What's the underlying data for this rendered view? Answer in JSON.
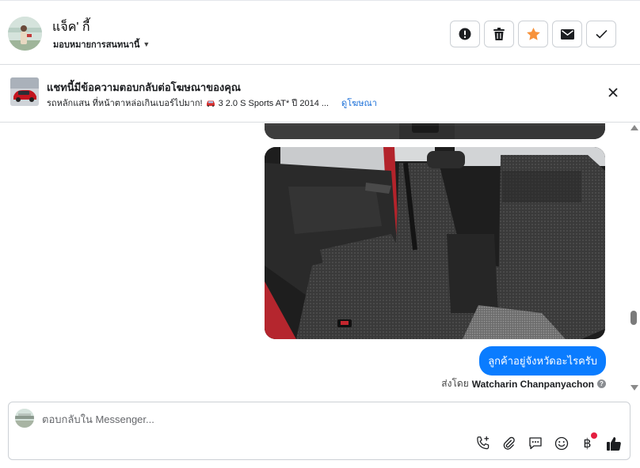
{
  "header": {
    "contact_name": "แจ็ค' กี้",
    "assign_label": "มอบหมายการสนทนานี้",
    "actions": [
      {
        "name": "spam-button",
        "icon": "exclamation-icon"
      },
      {
        "name": "delete-button",
        "icon": "trash-icon"
      },
      {
        "name": "star-button",
        "icon": "star-icon"
      },
      {
        "name": "mark-unread-button",
        "icon": "envelope-icon"
      },
      {
        "name": "mark-done-button",
        "icon": "check-icon"
      }
    ]
  },
  "ad_banner": {
    "title": "แชทนี้มีข้อความตอบกลับต่อโฆษณาของคุณ",
    "subtitle_prefix": "รถหลักแสน ที่หน้าตาหล่อเกินเบอร์ไปมาก!",
    "subtitle_suffix": "3 2.0 S Sports AT* ปี 2014 ...",
    "link_label": "ดูโฆษณา",
    "car_emoji_icon": "car-icon"
  },
  "thread": {
    "message_text": "ลูกค้าอยู่จังหวัดอะไรครับ",
    "sent_by_label": "ส่งโดย",
    "sender_name": "Watcharin Chanpanyachon",
    "info_icon": "?"
  },
  "composer": {
    "placeholder": "ตอบกลับใน Messenger..."
  },
  "colors": {
    "accent": "#0a7cff",
    "star": "#f7923b",
    "link": "#1a6fd8",
    "notification": "#e41e3f"
  }
}
